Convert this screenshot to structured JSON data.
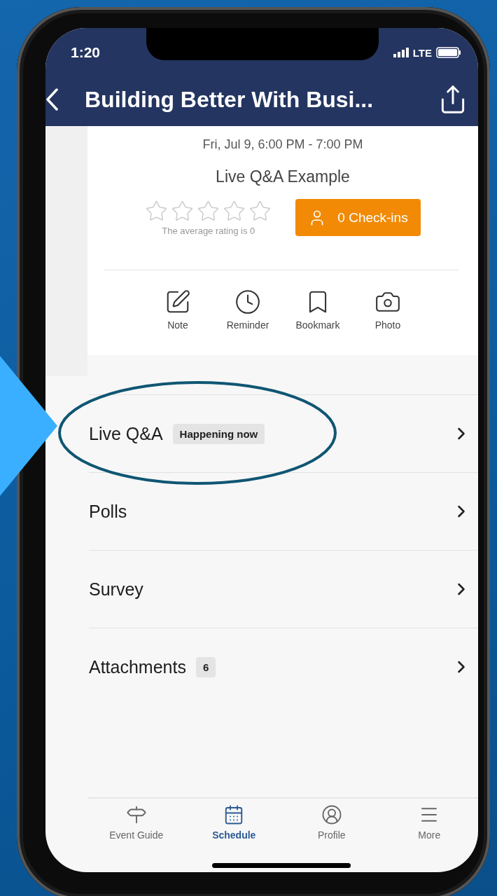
{
  "status_bar": {
    "time": "1:20",
    "network": "LTE"
  },
  "nav": {
    "title": "Building Better With Busi..."
  },
  "session": {
    "datetime": "Fri, Jul 9, 6:00 PM - 7:00 PM",
    "title": "Live Q&A Example",
    "stars": 0,
    "rating_text": "The average rating is 0",
    "checkin_button": "0 Check-ins"
  },
  "actions": [
    {
      "kind": "note",
      "label": "Note"
    },
    {
      "kind": "reminder",
      "label": "Reminder"
    },
    {
      "kind": "bookmark",
      "label": "Bookmark"
    },
    {
      "kind": "photo",
      "label": "Photo"
    }
  ],
  "rows": [
    {
      "label": "Live Q&A",
      "badge": "Happening now",
      "highlighted": true
    },
    {
      "label": "Polls",
      "highlighted": false
    },
    {
      "label": "Survey",
      "highlighted": false
    },
    {
      "label": "Attachments",
      "badge": "6",
      "highlighted": false
    }
  ],
  "tabs": [
    {
      "kind": "guide",
      "label": "Event Guide",
      "selected": false
    },
    {
      "kind": "schedule",
      "label": "Schedule",
      "selected": true
    },
    {
      "kind": "profile",
      "label": "Profile",
      "selected": false
    },
    {
      "kind": "more",
      "label": "More",
      "selected": false
    }
  ]
}
